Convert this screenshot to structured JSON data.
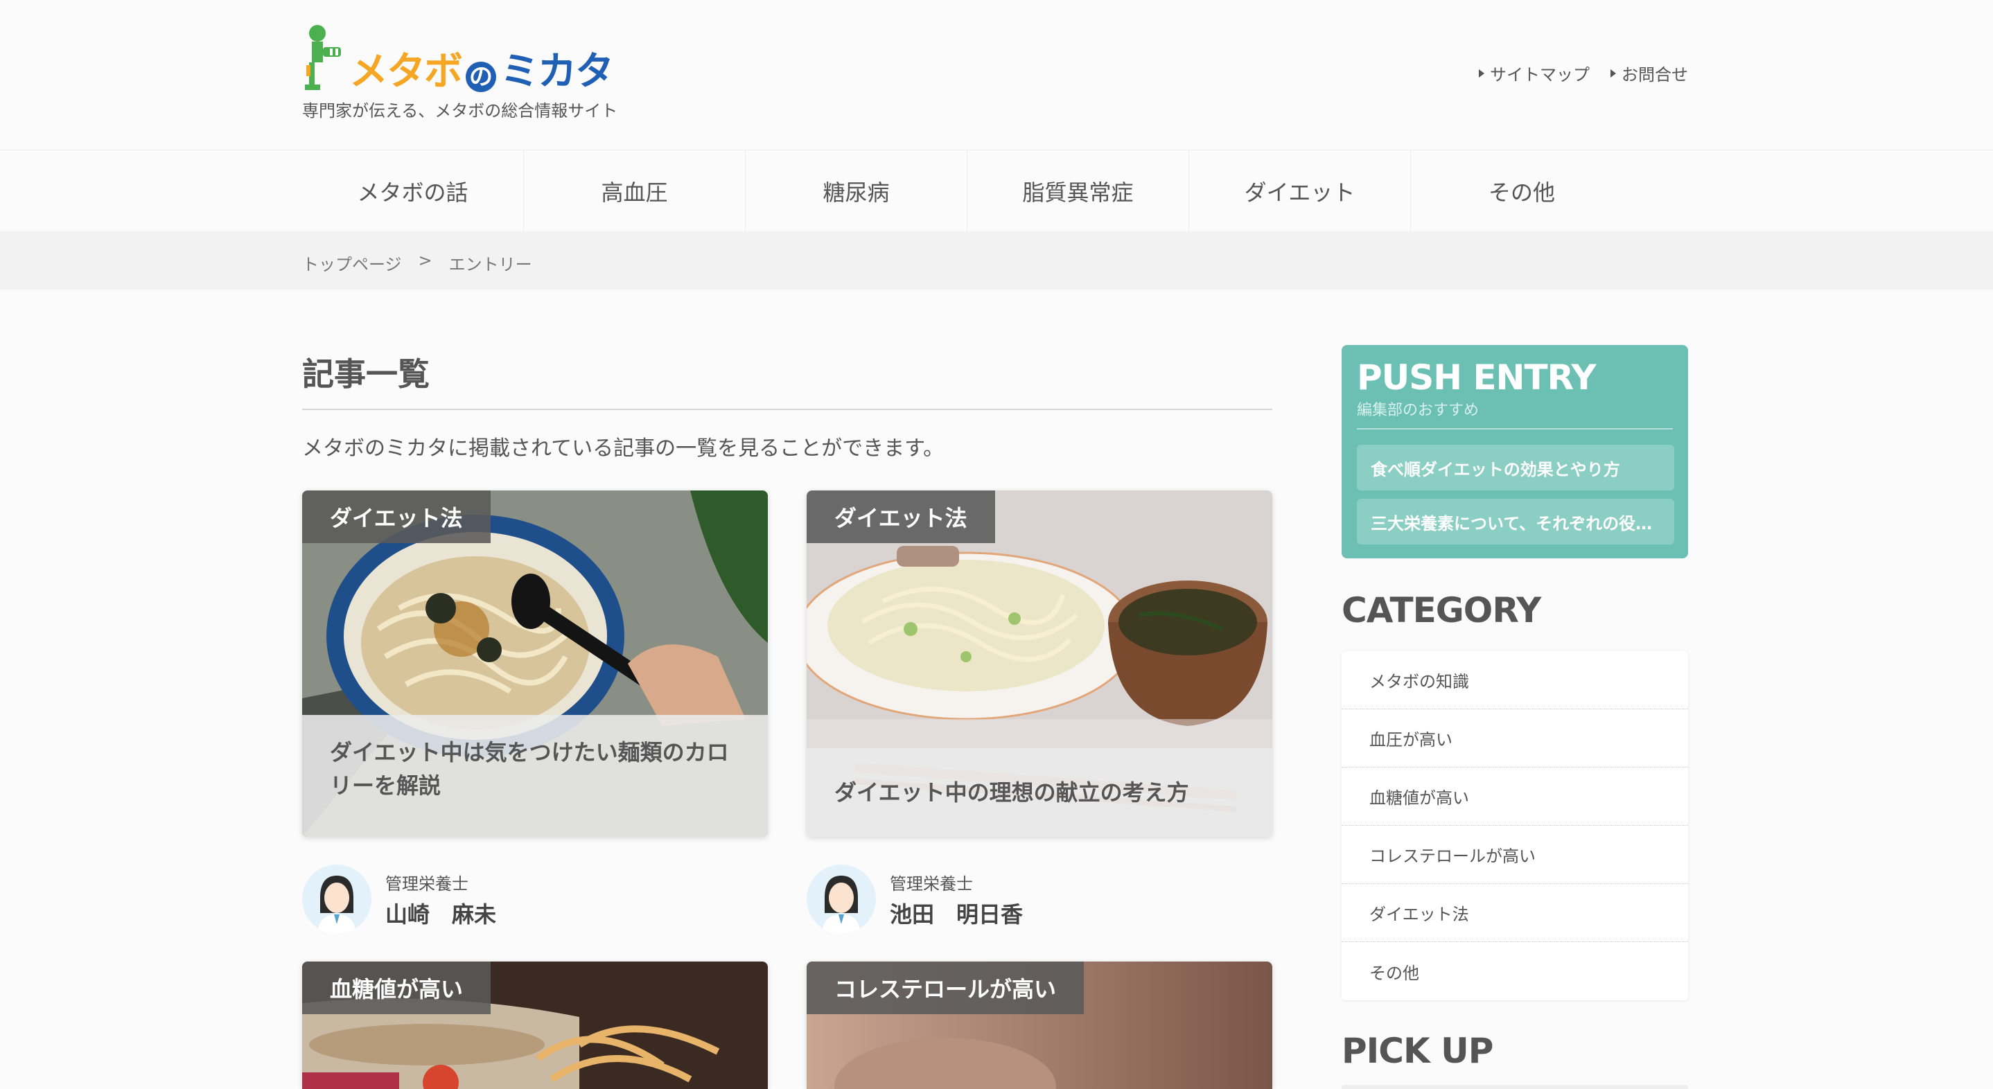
{
  "site": {
    "logo_parts": [
      "メタボ",
      "の",
      "ミカタ"
    ],
    "tagline": "専門家が伝える、メタボの総合情報サイト"
  },
  "util_nav": [
    "サイトマップ",
    "お問合せ"
  ],
  "global_nav": [
    "メタボの話",
    "高血圧",
    "糖尿病",
    "脂質異常症",
    "ダイエット",
    "その他"
  ],
  "breadcrumb": {
    "home": "トップページ",
    "separator": ">",
    "current": "エントリー"
  },
  "main": {
    "title": "記事一覧",
    "lead": "メタボのミカタに掲載されている記事の一覧を見ることができます。",
    "cards": [
      {
        "badge": "ダイエット法",
        "caption": "ダイエット中は気をつけたい麺類のカロリーを解説",
        "author_role": "管理栄養士",
        "author_name": "山崎　麻未"
      },
      {
        "badge": "ダイエット法",
        "caption": "ダイエット中の理想の献立の考え方",
        "author_role": "管理栄養士",
        "author_name": "池田　明日香"
      },
      {
        "badge": "血糖値が高い"
      },
      {
        "badge": "コレステロールが高い"
      }
    ]
  },
  "sidebar": {
    "push_title": "PUSH ENTRY",
    "push_sub": "編集部のおすすめ",
    "push_items": [
      "食べ順ダイエットの効果とやり方",
      "三大栄養素について、それぞれの役…"
    ],
    "category_heading": "CATEGORY",
    "categories": [
      "メタボの知識",
      "血圧が高い",
      "血糖値が高い",
      "コレステロールが高い",
      "ダイエット法",
      "その他"
    ],
    "pickup_heading": "PICK UP"
  },
  "colors": {
    "accent_teal": "#6bc0b3",
    "logo_orange": "#f5a623",
    "logo_blue": "#1f5fb4",
    "mascot_green": "#4caf50"
  }
}
